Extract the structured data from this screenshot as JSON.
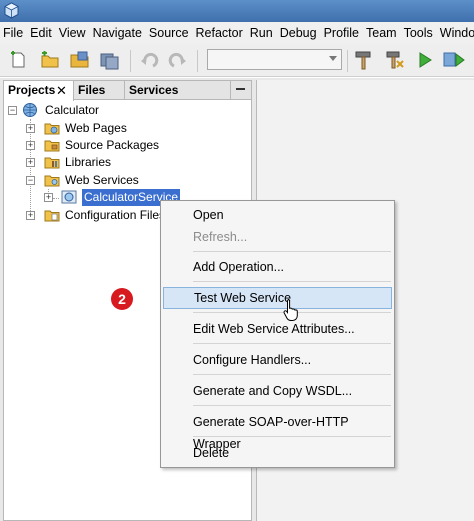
{
  "menubar": {
    "items": [
      "File",
      "Edit",
      "View",
      "Navigate",
      "Source",
      "Refactor",
      "Run",
      "Debug",
      "Profile",
      "Team",
      "Tools",
      "Window"
    ]
  },
  "toolbar": {
    "icons": [
      "new-file-icon",
      "new-project-icon",
      "open-project-icon",
      "save-all-icon",
      "undo-icon",
      "redo-icon",
      "clean-build-icon",
      "build-icon",
      "run-icon",
      "debug-icon"
    ],
    "config_value": ""
  },
  "projects_panel": {
    "tabs": [
      "Projects",
      "Files",
      "Services"
    ],
    "tree": {
      "root": "Calculator",
      "children": [
        "Web Pages",
        "Source Packages",
        "Libraries",
        "Web Services",
        "Configuration Files"
      ],
      "web_service": "CalculatorService"
    }
  },
  "context_menu": {
    "items": [
      {
        "label": "Open",
        "enabled": true
      },
      {
        "label": "Refresh...",
        "enabled": false
      },
      {
        "label": "Add Operation...",
        "enabled": true
      },
      {
        "label": "Test Web Service",
        "enabled": true
      },
      {
        "label": "Edit Web Service Attributes...",
        "enabled": true
      },
      {
        "label": "Configure Handlers...",
        "enabled": true
      },
      {
        "label": "Generate and Copy WSDL...",
        "enabled": true
      },
      {
        "label": "Generate SOAP-over-HTTP Wrapper",
        "enabled": true
      },
      {
        "label": "Delete",
        "enabled": true
      }
    ]
  },
  "step_badge": "2",
  "colors": {
    "selection": "#3a6fd0",
    "menu_hover": "#d6e6f7",
    "badge": "#d71920"
  }
}
